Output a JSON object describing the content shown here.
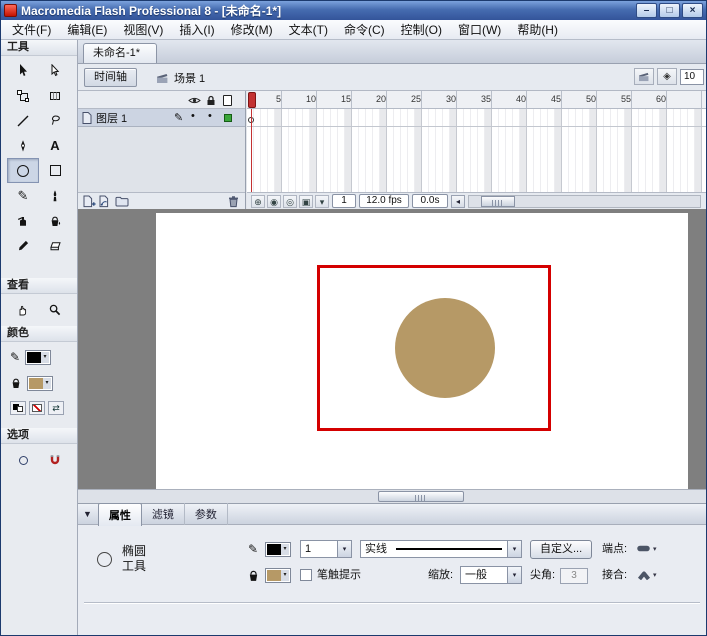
{
  "titlebar": {
    "title": "Macromedia Flash Professional 8 - [未命名-1*]",
    "buttons": {
      "minimize": "–",
      "maximize": "□",
      "close": "×"
    }
  },
  "menubar": {
    "items": [
      "文件(F)",
      "编辑(E)",
      "视图(V)",
      "插入(I)",
      "修改(M)",
      "文本(T)",
      "命令(C)",
      "控制(O)",
      "窗口(W)",
      "帮助(H)"
    ]
  },
  "tools_panel": {
    "tools_label": "工具",
    "view_label": "查看",
    "colors_label": "颜色",
    "options_label": "选项",
    "text_tool_glyph": "A",
    "pencil_glyph": "✎",
    "swap_colors_glyph": "⇄",
    "stroke_color": "#000000",
    "fill_color": "#b69966"
  },
  "document": {
    "tab": "未命名-1*"
  },
  "timeline": {
    "panel_button": "时间轴",
    "scene_name": "场景 1",
    "edit_symbol_glyph": "◈",
    "zoom_value": "10",
    "layer": {
      "name": "图层 1",
      "pencil_glyph": "✎",
      "show_dot": "•",
      "lock_dot": "•",
      "outline_color": "#3aa63a"
    },
    "ruler_numbers": [
      "5",
      "10",
      "15",
      "20",
      "25",
      "30",
      "35",
      "40",
      "45",
      "50",
      "55",
      "60"
    ],
    "status": {
      "icons": [
        "⊕",
        "◉",
        "◎",
        "▣",
        "▾"
      ],
      "current_frame": "1",
      "frame_rate": "12.0 fps",
      "elapsed_time": "0.0s",
      "scroll_left_glyph": "◂"
    }
  },
  "stage": {
    "rect_stroke": "#d40000",
    "circle_fill": "#b69966"
  },
  "properties": {
    "collapse_glyph": "▼",
    "tabs": {
      "t0": "属性",
      "t1": "滤镜",
      "t2": "参数"
    },
    "tool_name_line1": "椭圆",
    "tool_name_line2": "工具",
    "pencil_glyph": "✎",
    "stroke_color": "#000000",
    "fill_color": "#b69966",
    "stroke_height": "1",
    "stroke_style": "实线",
    "custom_button": "自定义...",
    "cap_label": "端点:",
    "stroke_hint_label": "笔触提示",
    "scale_label": "缩放:",
    "scale_value": "一般",
    "miter_label": "尖角:",
    "miter_value": "3",
    "join_label": "接合:",
    "dropdown_glyph": "▾"
  }
}
